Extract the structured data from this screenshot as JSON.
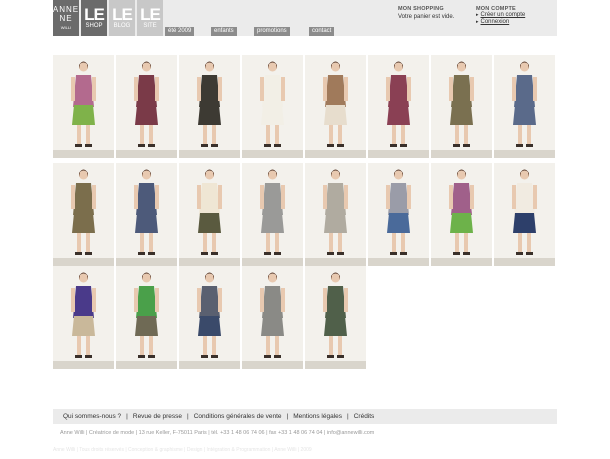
{
  "logo": {
    "line1": "ANNE",
    "line2": "NE",
    "sub": "WILLI"
  },
  "tiles": [
    {
      "name": "shop",
      "big": "LE",
      "small": "SHOP"
    },
    {
      "name": "blog",
      "big": "LE",
      "small": "BLOG"
    },
    {
      "name": "site",
      "big": "LE",
      "small": "SITE"
    }
  ],
  "nav": [
    "été 2009",
    "enfants",
    "promotions",
    "contact"
  ],
  "shopping": {
    "title": "MON SHOPPING",
    "text": "Votre panier est vide."
  },
  "account": {
    "title": "MON COMPTE",
    "links": [
      "Créer un compte",
      "Connexion"
    ]
  },
  "products": {
    "row1": [
      {
        "top": "#b36a8e",
        "bottom": "#7fb24a"
      },
      {
        "top": "#7a3a48",
        "bottom": "#7a3a48"
      },
      {
        "top": "#3d3a33",
        "bottom": "#3d3a33"
      },
      {
        "top": "#f2efe6",
        "bottom": "#f2efe6"
      },
      {
        "top": "#a07a5b",
        "bottom": "#e7ddcd"
      },
      {
        "top": "#8a4054",
        "bottom": "#8a4054"
      },
      {
        "top": "#7a7050",
        "bottom": "#7a7050"
      },
      {
        "top": "#5a6a8a",
        "bottom": "#5a6a8a"
      }
    ],
    "row2": [
      {
        "top": "#7b6e4c",
        "bottom": "#7b6e4c"
      },
      {
        "top": "#4d5a7a",
        "bottom": "#4d5a7a"
      },
      {
        "top": "#efe6d4",
        "bottom": "#5a5a3f"
      },
      {
        "top": "#9a9a98",
        "bottom": "#9a9a98"
      },
      {
        "top": "#b0aba0",
        "bottom": "#b0aba0"
      },
      {
        "top": "#9a9ca8",
        "bottom": "#4a6a9a"
      },
      {
        "top": "#a0608a",
        "bottom": "#6db24a"
      },
      {
        "top": "#f1ebe1",
        "bottom": "#2d3f6a"
      }
    ],
    "row3": [
      {
        "top": "#4a3a8a",
        "bottom": "#c9b89a"
      },
      {
        "top": "#4aa04a",
        "bottom": "#6f6a55"
      },
      {
        "top": "#5a6070",
        "bottom": "#3a4a6a"
      },
      {
        "top": "#8a8a86",
        "bottom": "#8a8a86"
      },
      {
        "top": "#50604a",
        "bottom": "#50604a"
      }
    ]
  },
  "footer": {
    "links": [
      "Qui sommes-nous ?",
      "Revue de presse",
      "Conditions générales de vente",
      "Mentions légales",
      "Crédits"
    ],
    "separator": "|",
    "address": "Anne Willi | Créatrice de mode | 13 rue Keller, F-75011 Paris | tél. +33 1 48 06 74 06 | fax +33 1 48 06 74 04 | info@annewilli.com",
    "credits": "Anne Willi | Tous droits réservés | Conception & graphisme | Design | Intégration & Programmation | Anne Willi | 2009"
  }
}
